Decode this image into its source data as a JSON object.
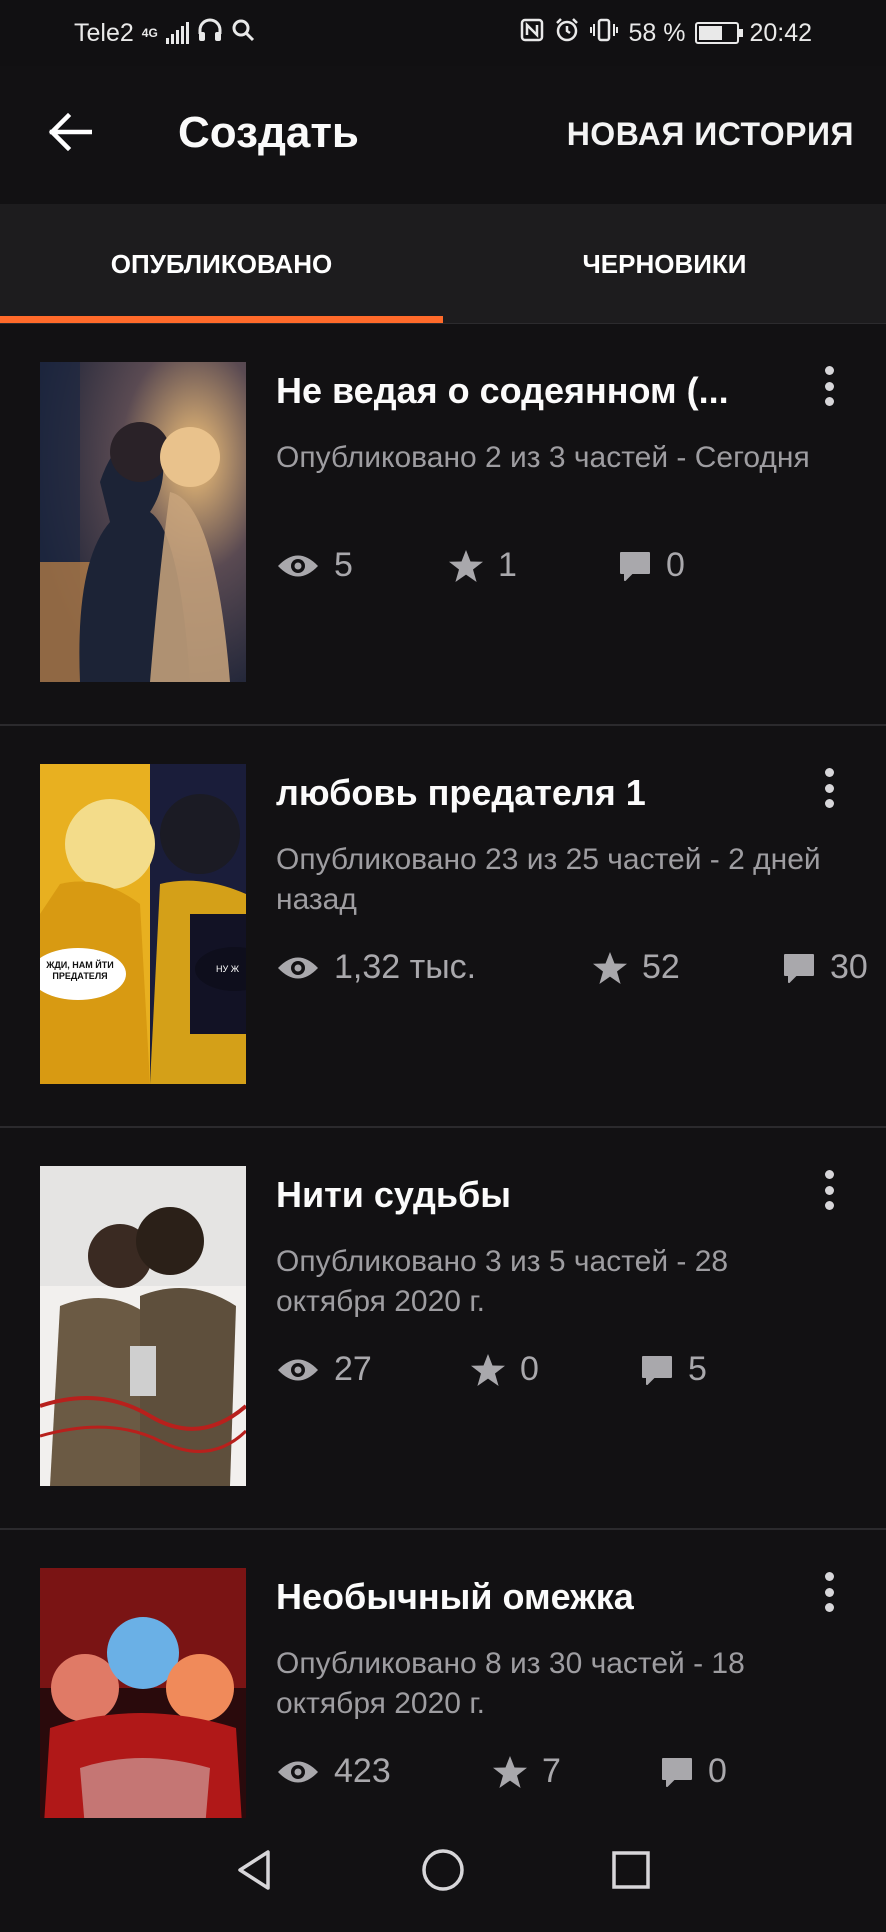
{
  "status_bar": {
    "carrier": "Tele2",
    "network": "4G",
    "battery": "58 %",
    "battery_level": 0.58,
    "time": "20:42",
    "icons": [
      "signal-icon",
      "headphones-icon",
      "search-icon",
      "nfc-icon",
      "alarm-icon",
      "vibrate-icon",
      "battery-icon"
    ]
  },
  "header": {
    "title": "Создать",
    "new_story_label": "НОВАЯ ИСТОРИЯ"
  },
  "tabs": [
    {
      "label": "ОПУБЛИКОВАНО",
      "active": true
    },
    {
      "label": "ЧЕРНОВИКИ",
      "active": false
    }
  ],
  "accent_color": "#ff6a2a",
  "stories": [
    {
      "title": "Не ведая о содеянном (...",
      "meta": "Опубликовано 2 из 3 частей - Сегодня",
      "views": "5",
      "votes": "1",
      "comments": "0"
    },
    {
      "title": "любовь предателя 1",
      "meta": "Опубликовано 23 из 25 частей - 2 дней назад",
      "views": "1,32 тыс.",
      "votes": "52",
      "comments": "30",
      "cover_text_left": "ЖДИ, НАМ ЙТИ ПРЕДАТЕЛЯ",
      "cover_text_right": "НУ Ж"
    },
    {
      "title": "Нити судьбы",
      "meta": "Опубликовано 3 из 5 частей - 28 октября 2020 г.",
      "views": "27",
      "votes": "0",
      "comments": "5"
    },
    {
      "title": "Необычный омежка",
      "meta": "Опубликовано 8 из 30 частей - 18 октября 2020 г.",
      "views": "423",
      "votes": "7",
      "comments": "0"
    }
  ],
  "nav_icons": [
    "back-triangle-icon",
    "home-circle-icon",
    "recents-square-icon"
  ]
}
